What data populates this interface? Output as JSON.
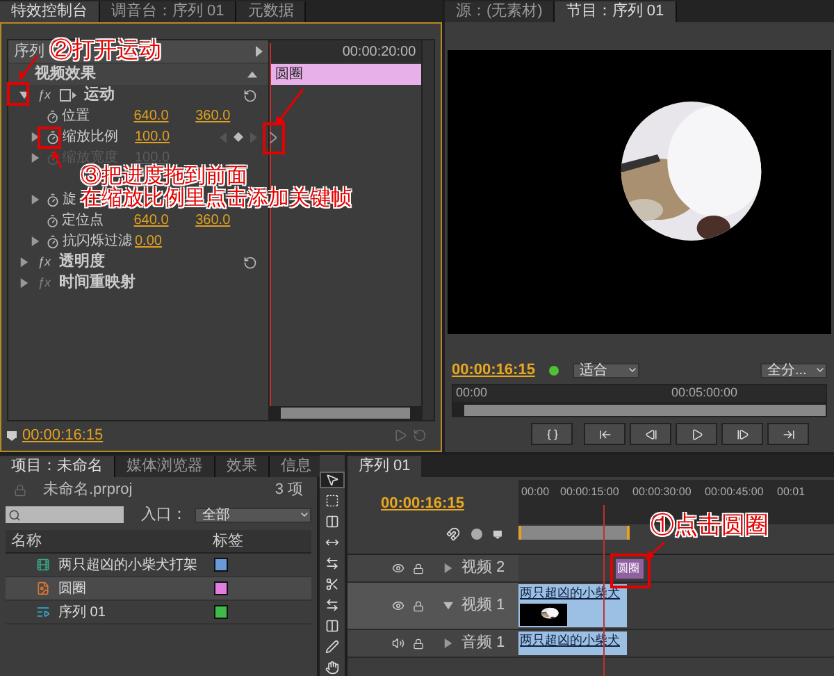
{
  "effect_controls": {
    "tabs": [
      {
        "label": "特效控制台",
        "selected": true
      },
      {
        "label": "调音台：序列 01",
        "selected": false
      },
      {
        "label": "元数据",
        "selected": false
      }
    ],
    "sequence_label": "序列",
    "ruler_time": "00:00:20:00",
    "clip_label": "圆圈",
    "section_title": "视频效果",
    "effects": [
      {
        "name": "运动",
        "badge": "ƒx",
        "expanded": true,
        "enabled": true,
        "reset": true,
        "properties": [
          {
            "name": "位置",
            "expandable": false,
            "disabled": false,
            "values": [
              "640.0",
              "360.0"
            ],
            "keyframe_nav": false
          },
          {
            "name": "缩放比例",
            "expandable": true,
            "disabled": false,
            "values": [
              "100.0"
            ],
            "keyframe_nav": true
          },
          {
            "name": "缩放宽度",
            "expandable": true,
            "disabled": true,
            "values": [
              "100.0"
            ],
            "keyframe_nav": false
          },
          {
            "name": "旋",
            "expandable": true,
            "disabled": false,
            "keyframe_nav": false
          },
          {
            "name": "定位点",
            "expandable": false,
            "disabled": false,
            "values": [
              "640.0",
              "360.0"
            ],
            "keyframe_nav": false
          },
          {
            "name": "抗闪烁过滤",
            "expandable": true,
            "disabled": false,
            "values": [
              "0.00"
            ],
            "keyframe_nav": false
          }
        ]
      },
      {
        "name": "透明度",
        "badge": "ƒx",
        "expanded": false,
        "enabled": true,
        "reset": true
      },
      {
        "name": "时间重映射",
        "badge": "ƒx",
        "expanded": false,
        "enabled": false,
        "reset": false
      }
    ],
    "timecode": "00:00:16:15"
  },
  "program_monitor": {
    "tabs": [
      {
        "label": "源：(无素材)",
        "selected": false
      },
      {
        "label": "节目：序列 01",
        "selected": true
      }
    ],
    "timecode": "00:00:16:15",
    "fit": "适合",
    "resolution": "全分...",
    "ruler": [
      "00:00",
      "00:05:00:00"
    ]
  },
  "project": {
    "tabs": [
      {
        "label": "项目：未命名",
        "selected": true
      },
      {
        "label": "媒体浏览器",
        "selected": false
      },
      {
        "label": "效果",
        "selected": false
      },
      {
        "label": "信息",
        "selected": false
      }
    ],
    "file": "未命名.prproj",
    "count": "3 项",
    "entry_label": "入口：",
    "entry_value": "全部",
    "columns": [
      "名称",
      "标签"
    ],
    "items": [
      {
        "name": "两只超凶的小柴犬打架",
        "kind": "video",
        "color": "#6a9ad8",
        "selected": false
      },
      {
        "name": "圆圈",
        "kind": "title",
        "color": "#e27ee0",
        "selected": true
      },
      {
        "name": "序列 01",
        "kind": "sequence",
        "color": "#3fb94a",
        "selected": false
      }
    ]
  },
  "timeline": {
    "tab": "序列 01",
    "timecode": "00:00:16:15",
    "ruler": [
      "00:00",
      "00:00:15:00",
      "00:00:30:00",
      "00:00:45:00",
      "00:01"
    ],
    "tracks": [
      {
        "name": "视频 2",
        "kind": "video",
        "expanded": false,
        "clip": {
          "label": "圆圈",
          "kind": "title"
        }
      },
      {
        "name": "视频 1",
        "kind": "video",
        "expanded": true,
        "clip": {
          "label": "两只超凶的小柴犬",
          "kind": "video"
        }
      },
      {
        "name": "音频 1",
        "kind": "audio",
        "expanded": false,
        "clip": {
          "label": "两只超凶的小柴犬",
          "kind": "audio"
        }
      }
    ]
  },
  "annotations": [
    "②打开运动",
    "③把进度拖到前面",
    "在缩放比例里点击添加关键帧",
    "①点击圆圈"
  ]
}
